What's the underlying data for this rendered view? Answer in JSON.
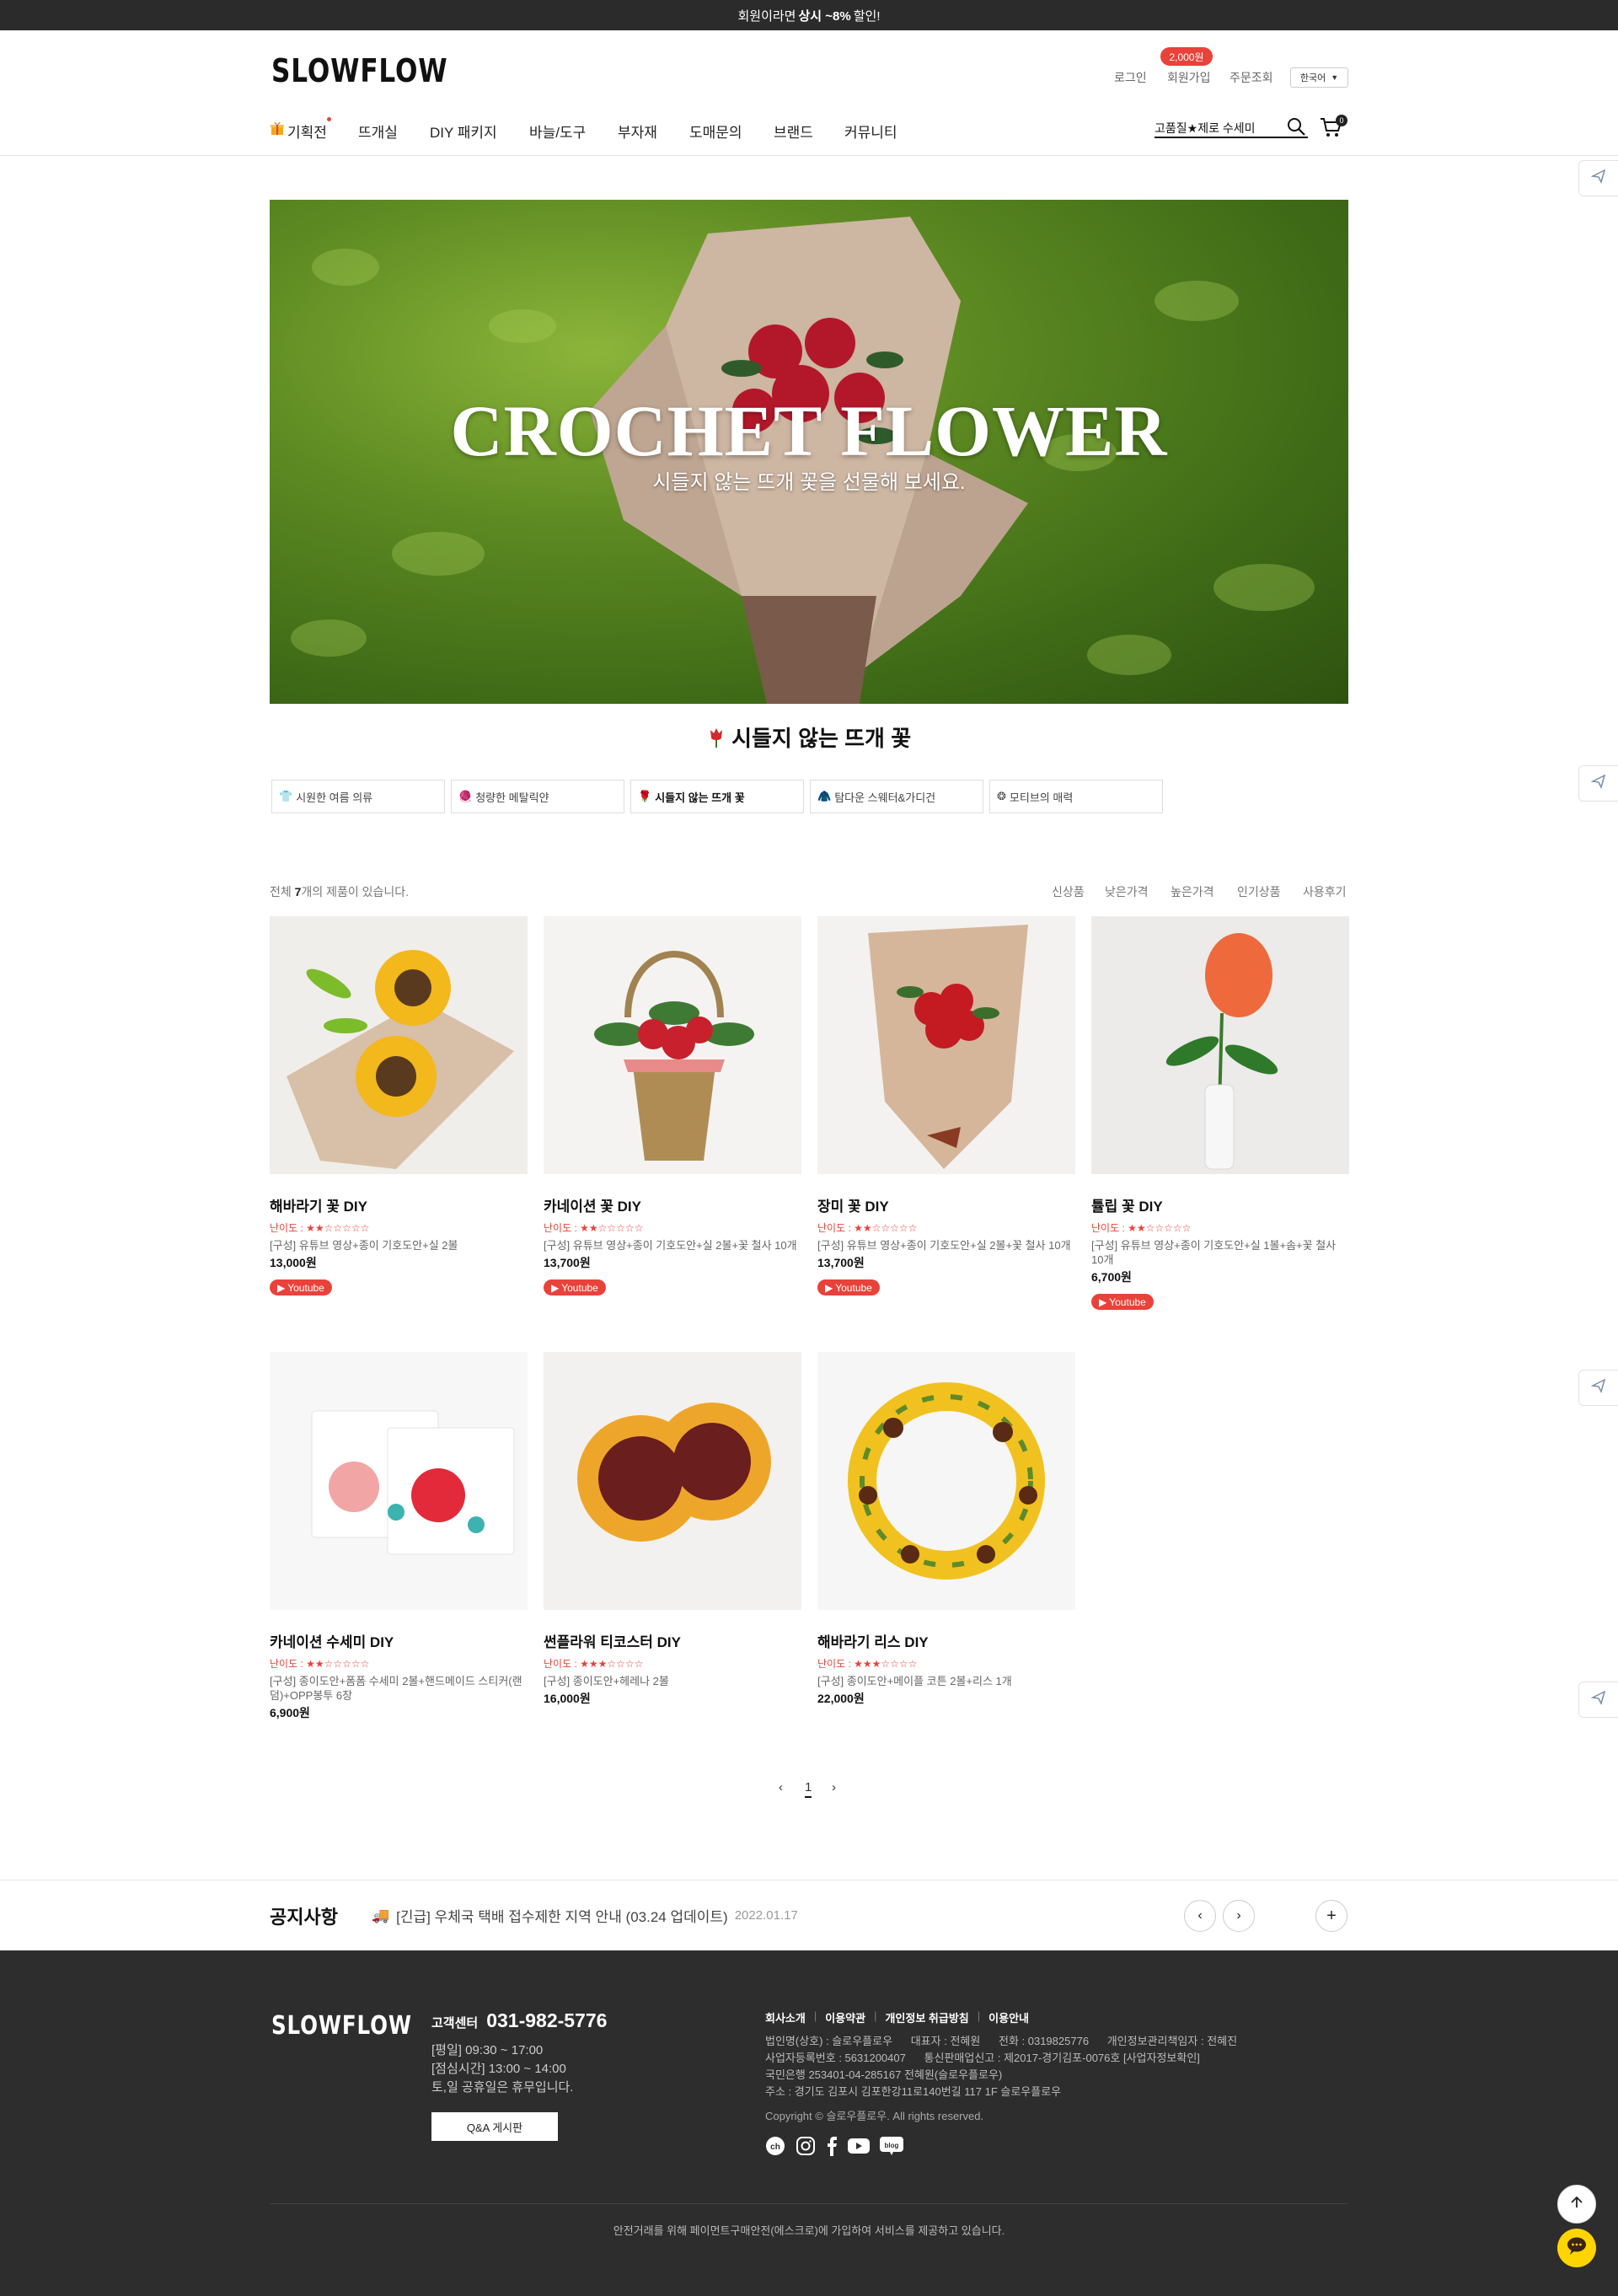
{
  "topbar": {
    "prefix": "회원이라면",
    "highlight": "상시 ~8%",
    "suffix": "할인!"
  },
  "header": {
    "logo": "SLOWFLOW",
    "util": {
      "login": "로그인",
      "join": "회원가입",
      "orders": "주문조회",
      "join_badge": "2,000원",
      "lang": "한국어"
    },
    "nav": [
      "기획전",
      "뜨개실",
      "DIY 패키지",
      "바늘/도구",
      "부자재",
      "도매문의",
      "브랜드",
      "커뮤니티"
    ],
    "search_text": "고품질★제로 수세미",
    "cart_count": "0"
  },
  "hero": {
    "title": "CROCHET FLOWER",
    "subtitle": "시들지 않는 뜨개 꽃을 선물해 보세요."
  },
  "section_title": "시들지 않는 뜨개 꽃",
  "category_tabs": [
    "시원한 여름 의류",
    "청량한 메탈릭얀",
    "시들지 않는 뜨개 꽃",
    "탐다운 스웨터&가디건",
    "모티브의 매력"
  ],
  "listing": {
    "count_prefix": "전체",
    "count": "7",
    "count_suffix": "개의 제품이 있습니다.",
    "sort": [
      "신상품",
      "낮은가격",
      "높은가격",
      "인기상품",
      "사용후기"
    ]
  },
  "products": [
    {
      "name": "해바라기 꽃 DIY",
      "difficulty": "난이도 : ★★☆☆☆☆☆",
      "composition": "[구성] 유튜브 영상+종이 기호도안+실 2볼",
      "price": "13,000원",
      "youtube": "Youtube"
    },
    {
      "name": "카네이션 꽃 DIY",
      "difficulty": "난이도 : ★★☆☆☆☆☆",
      "composition": "[구성] 유튜브 영상+종이 기호도안+실 2볼+꽃 철사 10개",
      "price": "13,700원",
      "youtube": "Youtube"
    },
    {
      "name": "장미 꽃 DIY",
      "difficulty": "난이도 : ★★☆☆☆☆☆",
      "composition": "[구성] 유튜브 영상+종이 기호도안+실 2볼+꽃 철사 10개",
      "price": "13,700원",
      "youtube": "Youtube"
    },
    {
      "name": "튤립 꽃 DIY",
      "difficulty": "난이도 : ★★☆☆☆☆☆",
      "composition": "[구성] 유튜브 영상+종이 기호도안+실 1볼+솜+꽃 철사 10개",
      "price": "6,700원",
      "youtube": "Youtube"
    },
    {
      "name": "카네이션 수세미 DIY",
      "difficulty": "난이도 : ★★☆☆☆☆☆",
      "composition": "[구성] 종이도안+폼폼 수세미 2볼+핸드메이드 스티커(랜덤)+OPP봉투 6장",
      "price": "6,900원"
    },
    {
      "name": "썬플라워 티코스터 DIY",
      "difficulty": "난이도 : ★★★☆☆☆☆",
      "composition": "[구성] 종이도안+헤레나 2볼",
      "price": "16,000원"
    },
    {
      "name": "해바라기 리스 DIY",
      "difficulty": "난이도 : ★★★☆☆☆☆",
      "composition": "[구성] 종이도안+메이플 코튼 2볼+리스 1개",
      "price": "22,000원"
    }
  ],
  "pagination": {
    "current": "1"
  },
  "notice": {
    "title": "공지사항",
    "text": "[긴급] 우체국 택배 접수제한 지역 안내 (03.24 업데이트)",
    "date": "2022.01.17"
  },
  "footer": {
    "logo": "SLOWFLOW",
    "cs_label": "고객센터",
    "cs_phone": "031-982-5776",
    "hours": [
      "[평일] 09:30 ~ 17:00",
      "[점심시간] 13:00 ~ 14:00",
      "토,일 공휴일은 휴무입니다."
    ],
    "qa_button": "Q&A 게시판",
    "links": [
      "회사소개",
      "이용약관",
      "개인정보 취급방침",
      "이용안내"
    ],
    "info": [
      "법인명(상호) : 슬로우플로우      대표자 : 전혜원      전화 : 0319825776      개인정보관리책임자 : 전혜진",
      "사업자등록번호 : 5631200407      통신판매업신고 : 제2017-경기김포-0076호 [사업자정보확인]",
      "국민은행 253401-04-285167 전혜원(슬로우플로우)",
      "주소 : 경기도 김포시 김포한강11로140번길 117 1F 슬로우플로우"
    ],
    "copyright": "Copyright © 슬로우플로우. All rights reserved.",
    "sns": [
      "channel-icon",
      "instagram-icon",
      "facebook-icon",
      "youtube-icon",
      "blog-icon"
    ],
    "bottom": "안전거래를 위해 페이먼트구매안전(에스크로)에 가입하여 서비스를 제공하고 있습니다."
  },
  "colors": {
    "accent": "#e9423a",
    "dark": "#2d2d2d",
    "kakao": "#ffd400"
  }
}
